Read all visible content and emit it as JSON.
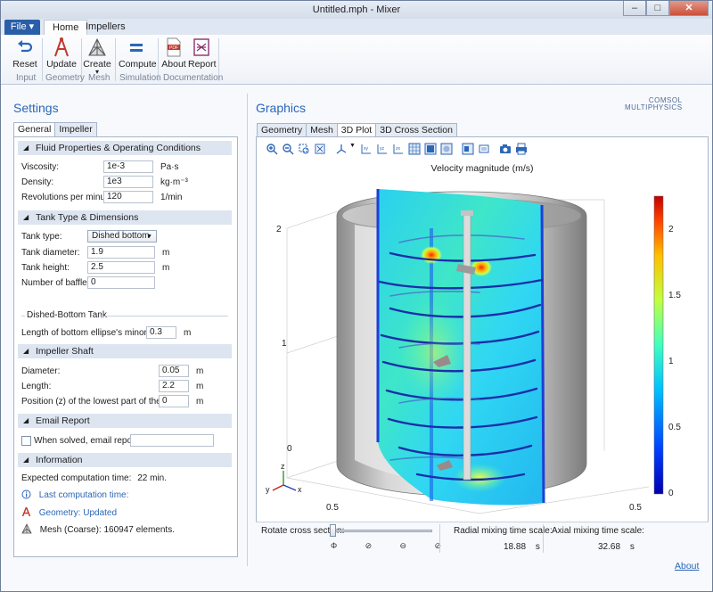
{
  "window": {
    "title": "Untitled.mph - Mixer",
    "controls": [
      "–",
      "□",
      "✕"
    ]
  },
  "ribbon": {
    "file_label": "File ▾",
    "tabs": [
      "Home",
      "Impellers"
    ],
    "buttons": [
      {
        "label": "Reset",
        "icon": "reset-arrow-icon"
      },
      {
        "label": "Update",
        "icon": "update-geometry-icon"
      },
      {
        "label": "Create",
        "icon": "create-mesh-icon",
        "dropdown": "▾"
      },
      {
        "label": "Compute",
        "icon": "compute-equals-icon"
      },
      {
        "label": "About",
        "icon": "about-pdf-icon"
      },
      {
        "label": "Report",
        "icon": "report-icon"
      }
    ],
    "groups": [
      "Input",
      "Geometry",
      "Mesh",
      "Simulation",
      "Documentation"
    ]
  },
  "settings": {
    "title": "Settings",
    "tabs": [
      "General",
      "Impeller"
    ],
    "fluid": {
      "header": "Fluid Properties & Operating Conditions",
      "viscosity_label": "Viscosity:",
      "viscosity_value": "1e-3",
      "viscosity_unit": "Pa·s",
      "density_label": "Density:",
      "density_value": "1e3",
      "density_unit": "kg·m⁻³",
      "rpm_label": "Revolutions per minute:",
      "rpm_value": "120",
      "rpm_unit": "1/min"
    },
    "tank": {
      "header": "Tank Type & Dimensions",
      "type_label": "Tank type:",
      "type_value": "Dished bottom",
      "diameter_label": "Tank diameter:",
      "diameter_value": "1.9",
      "diameter_unit": "m",
      "height_label": "Tank height:",
      "height_value": "2.5",
      "height_unit": "m",
      "baffles_label": "Number of baffles:",
      "baffles_value": "0",
      "dished_header": "Dished-Bottom Tank",
      "ellipse_label": "Length of bottom ellipse's minor axis:",
      "ellipse_value": "0.3",
      "ellipse_unit": "m"
    },
    "shaft": {
      "header": "Impeller Shaft",
      "diameter_label": "Diameter:",
      "diameter_value": "0.05",
      "diameter_unit": "m",
      "length_label": "Length:",
      "length_value": "2.2",
      "length_unit": "m",
      "position_label": "Position (z) of the lowest part of the shaft:",
      "position_value": "0",
      "position_unit": "m"
    },
    "email": {
      "header": "Email Report",
      "checkbox_label": "When solved, email report to:",
      "email_value": ""
    },
    "information": {
      "header": "Information",
      "expected_label": "Expected computation time:",
      "expected_value": "22 min.",
      "last_label": "Last computation time:",
      "geometry_label": "Geometry: Updated",
      "mesh_label": "Mesh (Coarse): 160947 elements."
    }
  },
  "graphics": {
    "title": "Graphics",
    "brand_line1": "COMSOL",
    "brand_line2": "MULTIPHYSICS",
    "tabs": [
      "Geometry",
      "Mesh",
      "3D Plot",
      "3D Cross Section"
    ],
    "plot_title": "Velocity magnitude (m/s)",
    "z_ticks": [
      "2",
      "1",
      "0"
    ],
    "x_ticks": [
      "0.5",
      "0.5"
    ],
    "colorbar_ticks": [
      "2",
      "1.5",
      "1",
      "0.5",
      "0"
    ],
    "axes": [
      "z",
      "y",
      "x"
    ],
    "controls": {
      "rotate_label": "Rotate cross section:",
      "rotate_value": 0.0,
      "rotate_ticks": [
        "Φ",
        "⊘",
        "⊖",
        "⊘"
      ],
      "radial_label": "Radial mixing time scale:",
      "radial_value": "18.88",
      "radial_unit": "s",
      "axial_label": "Axial mixing time scale:",
      "axial_value": "32.68",
      "axial_unit": "s"
    }
  },
  "footer": {
    "about_link": "About"
  },
  "colors": {
    "accent": "#2b66b8",
    "ribbon_bg": "#eef2f8",
    "section_bg": "#dde5f0"
  }
}
